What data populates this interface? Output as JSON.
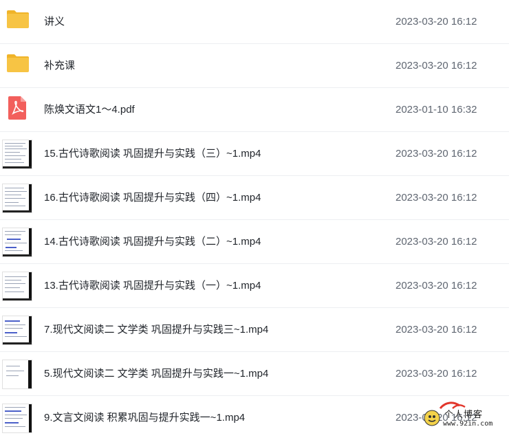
{
  "files": [
    {
      "kind": "folder",
      "icon": "folder-icon",
      "name": "讲义",
      "date": "2023-03-20 16:12"
    },
    {
      "kind": "folder",
      "icon": "folder-icon",
      "name": "补充课",
      "date": "2023-03-20 16:12"
    },
    {
      "kind": "pdf",
      "icon": "pdf-icon",
      "name": "陈焕文语文1～4.pdf",
      "date": "2023-01-10 16:32"
    },
    {
      "kind": "video",
      "icon": "video-thumbnail",
      "name": "15.古代诗歌阅读 巩固提升与实践（三）~1.mp4",
      "date": "2023-03-20 16:12"
    },
    {
      "kind": "video",
      "icon": "video-thumbnail",
      "name": "16.古代诗歌阅读 巩固提升与实践（四）~1.mp4",
      "date": "2023-03-20 16:12"
    },
    {
      "kind": "video",
      "icon": "video-thumbnail",
      "name": "14.古代诗歌阅读 巩固提升与实践（二）~1.mp4",
      "date": "2023-03-20 16:12"
    },
    {
      "kind": "video",
      "icon": "video-thumbnail",
      "name": "13.古代诗歌阅读 巩固提升与实践（一）~1.mp4",
      "date": "2023-03-20 16:12"
    },
    {
      "kind": "video",
      "icon": "video-thumbnail",
      "name": "7.现代文阅读二 文学类 巩固提升与实践三~1.mp4",
      "date": "2023-03-20 16:12"
    },
    {
      "kind": "video",
      "icon": "video-thumbnail",
      "name": "5.现代文阅读二 文学类 巩固提升与实践一~1.mp4",
      "date": "2023-03-20 16:12"
    },
    {
      "kind": "video",
      "icon": "video-thumbnail",
      "name": "9.文言文阅读 积累巩固与提升实践一~1.mp4",
      "date": "2023-03-20 16:12"
    }
  ],
  "watermark": {
    "title": "个人博客",
    "url": "www.92in.com"
  },
  "colors": {
    "folder": "#f7c444",
    "folder_dark": "#f0b429",
    "pdf": "#f25f5c",
    "date_text": "#5f6671",
    "name_text": "#1f2329",
    "divider": "#eceef1"
  }
}
